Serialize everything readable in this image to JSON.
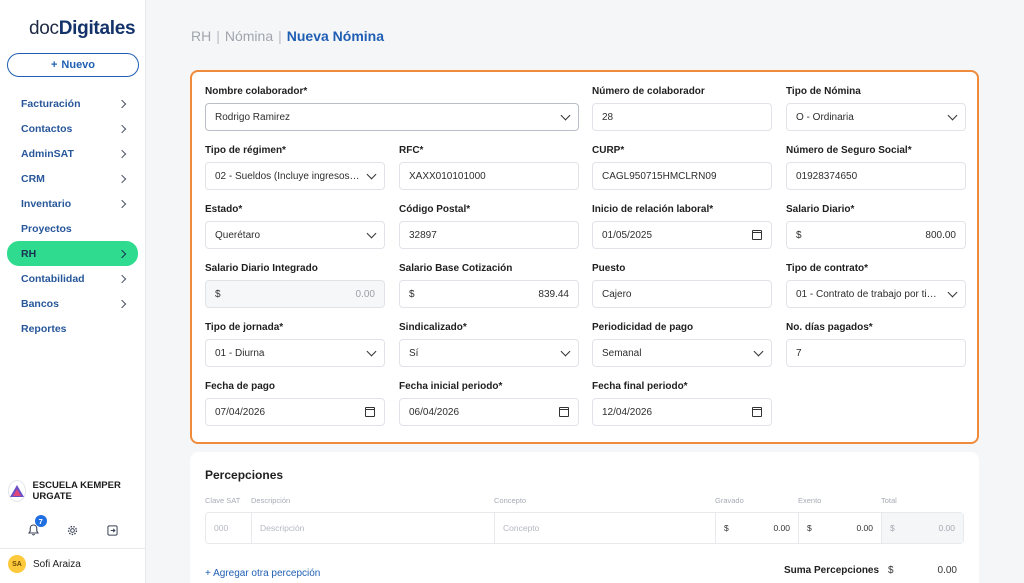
{
  "sidebar": {
    "logo_a": "doc",
    "logo_b": "Digitales",
    "new_button": "Nuevo",
    "items": [
      {
        "label": "Facturación",
        "chevron": true
      },
      {
        "label": "Contactos",
        "chevron": true
      },
      {
        "label": "AdminSAT",
        "chevron": true
      },
      {
        "label": "CRM",
        "chevron": true
      },
      {
        "label": "Inventario",
        "chevron": true
      },
      {
        "label": "Proyectos",
        "chevron": false
      },
      {
        "label": "RH",
        "chevron": true,
        "active": true
      },
      {
        "label": "Contabilidad",
        "chevron": true
      },
      {
        "label": "Bancos",
        "chevron": true
      },
      {
        "label": "Reportes",
        "chevron": false
      }
    ],
    "org_name": "ESCUELA KEMPER URGATE",
    "notifications_count": "7",
    "user_initials": "SA",
    "user_name": "Sofi Araiza"
  },
  "breadcrumb": {
    "a": "RH",
    "b": "Nómina",
    "c": "Nueva Nómina",
    "sep": "|"
  },
  "form": {
    "nombre": {
      "label": "Nombre colaborador*",
      "value": "Rodrigo Ramirez"
    },
    "numero": {
      "label": "Número de colaborador",
      "value": "28"
    },
    "tipo_nomina": {
      "label": "Tipo de Nómina",
      "value": "O - Ordinaria"
    },
    "regimen": {
      "label": "Tipo de régimen*",
      "value": "02 - Sueldos (Incluye ingresos se..."
    },
    "rfc": {
      "label": "RFC*",
      "value": "XAXX010101000"
    },
    "curp": {
      "label": "CURP*",
      "value": "CAGL950715HMCLRN09"
    },
    "nss": {
      "label": "Número de Seguro Social*",
      "value": "01928374650"
    },
    "estado": {
      "label": "Estado*",
      "value": "Querétaro"
    },
    "cp": {
      "label": "Código Postal*",
      "value": "32897"
    },
    "inicio": {
      "label": "Inicio de relación laboral*",
      "value": "01/05/2025"
    },
    "salario_diario": {
      "label": "Salario Diario*",
      "currency": "$",
      "value": "800.00"
    },
    "sdi": {
      "label": "Salario Diario Integrado",
      "currency": "$",
      "value": "0.00"
    },
    "sbc": {
      "label": "Salario Base Cotización",
      "currency": "$",
      "value": "839.44"
    },
    "puesto": {
      "label": "Puesto",
      "value": "Cajero"
    },
    "contrato": {
      "label": "Tipo de contrato*",
      "value": "01 - Contrato de trabajo por tiem..."
    },
    "jornada": {
      "label": "Tipo de jornada*",
      "value": "01 - Diurna"
    },
    "sindicalizado": {
      "label": "Sindicalizado*",
      "value": "Sí"
    },
    "periodicidad": {
      "label": "Periodicidad de pago",
      "value": "Semanal"
    },
    "dias": {
      "label": "No. días pagados*",
      "value": "7"
    },
    "fecha_pago": {
      "label": "Fecha de pago",
      "value": "07/04/2026"
    },
    "fecha_ini": {
      "label": "Fecha inicial periodo*",
      "value": "06/04/2026"
    },
    "fecha_fin": {
      "label": "Fecha final periodo*",
      "value": "12/04/2026"
    }
  },
  "percepciones": {
    "title": "Percepciones",
    "headers": {
      "clave": "Clave SAT",
      "descripcion": "Descripción",
      "concepto": "Concepto",
      "gravado": "Gravado",
      "exento": "Exento",
      "total": "Total"
    },
    "row": {
      "clave_ph": "000",
      "descripcion_ph": "Descripción",
      "concepto_ph": "Concepto",
      "currency": "$",
      "gravado": "0.00",
      "exento": "0.00",
      "total": "0.00"
    },
    "add_link": "+ Agregar otra percepción",
    "suma_label": "Suma Percepciones",
    "suma_currency": "$",
    "suma_value": "0.00"
  },
  "colors": {
    "accent": "#1f5fb3",
    "active_nav": "#2fdc8f",
    "highlight_border": "#ef8b3b"
  }
}
